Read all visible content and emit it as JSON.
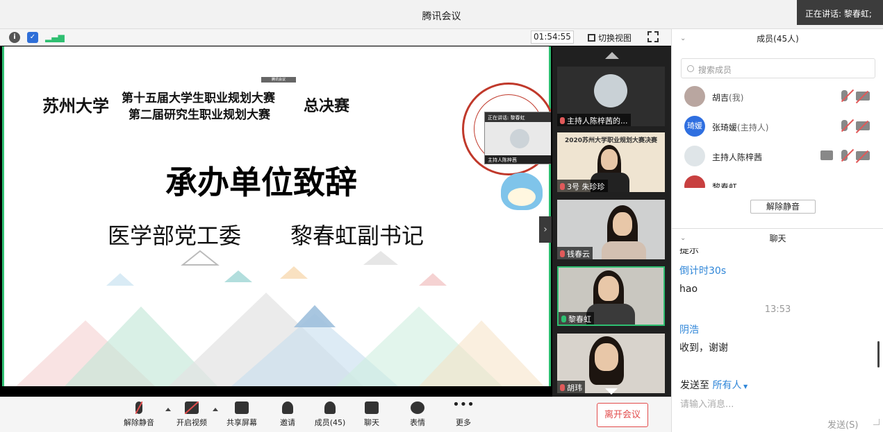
{
  "app": {
    "title": "腾讯会议",
    "speaking": "正在讲话: 黎春虹;"
  },
  "toolbar": {
    "timer": "01:54:55",
    "switch_view": "切换视图"
  },
  "slide": {
    "university": "苏州大学",
    "competition_1": "第十五届大学生职业规划大赛",
    "competition_2": "第二届研究生职业规划大赛",
    "final": "总决赛",
    "heading": "承办单位致辞",
    "department": "医学部党工委",
    "speaker": "黎春虹副书记",
    "pip_bar": "正在讲话: 黎春虹",
    "pip_foot": "主持人陈梓茜",
    "sharer": "腾讯会议"
  },
  "gallery": {
    "tiles": [
      {
        "label": "主持人陈梓茜的..."
      },
      {
        "label": "3号 朱珍珍",
        "banner": "2020苏州大学职业规划大赛决赛"
      },
      {
        "label": "钱春云"
      },
      {
        "label": "黎春虹"
      },
      {
        "label": "胡玮"
      }
    ]
  },
  "bottom_bar": {
    "unmute": "解除静音",
    "video": "开启视频",
    "share": "共享屏幕",
    "invite": "邀请",
    "members": "成员(45)",
    "chat": "聊天",
    "emoji": "表情",
    "more": "更多",
    "leave": "离开会议"
  },
  "members_panel": {
    "title": "成员(45人)",
    "search_placeholder": "搜索成员",
    "unmute_all": "解除静音",
    "members": [
      {
        "name": "胡吉",
        "role": "(我)"
      },
      {
        "name": "张琦媛",
        "role": "(主持人)",
        "avatar_text": "琦媛"
      },
      {
        "name": "主持人陈梓茜",
        "role": ""
      },
      {
        "name": "黎春虹",
        "role": ""
      }
    ]
  },
  "chat_panel": {
    "title": "聊天",
    "messages": [
      {
        "text": "提示"
      },
      {
        "sender": "倒计时30s"
      },
      {
        "text": "hao"
      },
      {
        "time": "13:53"
      },
      {
        "sender": "阴浩"
      },
      {
        "text": "收到，谢谢"
      }
    ],
    "send_to_label": "发送至",
    "send_to_target": "所有人",
    "input_placeholder": "请输入消息...",
    "send": "发送(S)"
  },
  "colors": {
    "accent": "#2f86d8",
    "danger": "#e24b4b",
    "active_border": "#2fbf71"
  }
}
